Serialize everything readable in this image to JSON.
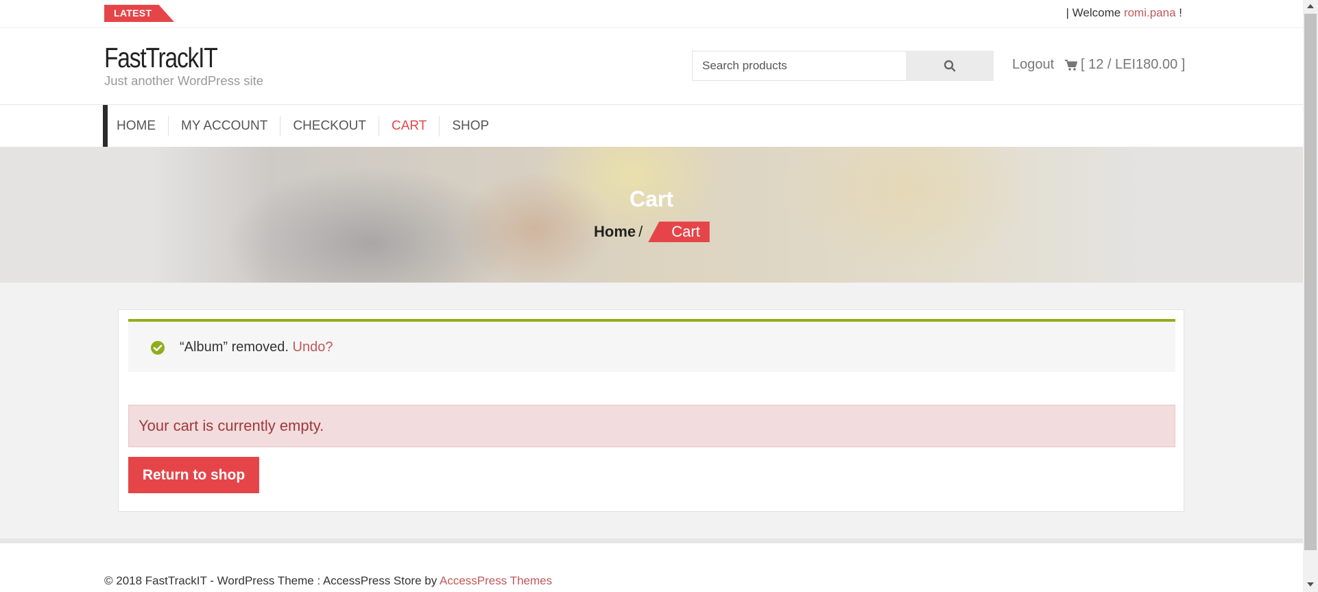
{
  "topbar": {
    "latest_label": "LATEST",
    "welcome_prefix": "| Welcome ",
    "username": "romi.pana",
    "welcome_suffix": " !"
  },
  "header": {
    "site_title": "FastTrackIT",
    "tagline": "Just another WordPress site",
    "search_placeholder": "Search products",
    "search_icon": "search-icon",
    "logout_label": "Logout",
    "cart_icon": "shopping-cart-icon",
    "cart_summary": "[ 12 / LEI180.00 ]"
  },
  "nav": {
    "items": [
      {
        "label": "HOME"
      },
      {
        "label": "MY ACCOUNT"
      },
      {
        "label": "CHECKOUT"
      },
      {
        "label": "CART",
        "active": true
      },
      {
        "label": "SHOP"
      }
    ]
  },
  "banner": {
    "title": "Cart",
    "breadcrumb_home": "Home",
    "breadcrumb_separator": "/",
    "breadcrumb_current": "Cart"
  },
  "notice": {
    "icon": "check-circle-icon",
    "message": "“Album” removed.",
    "undo_label": "Undo?"
  },
  "cart": {
    "empty_message": "Your cart is currently empty.",
    "return_button": "Return to shop"
  },
  "footer": {
    "copyright": "© 2018 FastTrackIT - WordPress Theme : AccessPress Store by ",
    "theme_link": "AccessPress Themes"
  },
  "colors": {
    "accent": "#e54549",
    "link": "#c0575a",
    "success": "#8fae1b",
    "error_bg": "#f2dcdd"
  }
}
